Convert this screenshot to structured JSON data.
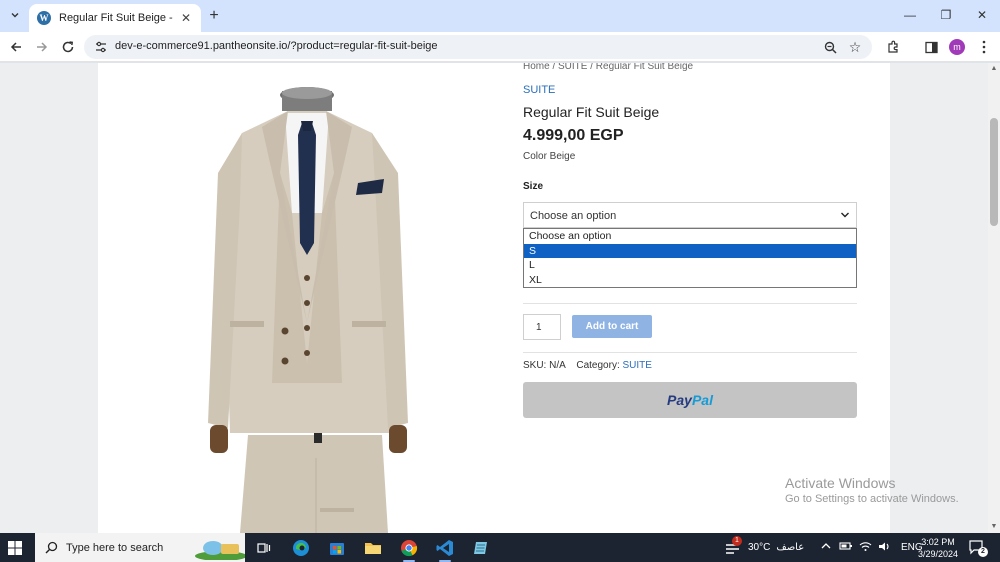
{
  "browser": {
    "tab_title": "Regular Fit Suit Beige -",
    "url": "dev-e-commerce91.pantheonsite.io/?product=regular-fit-suit-beige",
    "profile_initial": "m"
  },
  "product": {
    "breadcrumb": "Home / SUITE / Regular Fit Suit Beige",
    "category_link": "SUITE",
    "title": "Regular Fit Suit Beige",
    "price": "4.999,00 EGP",
    "color_line": "Color Beige",
    "size_label": "Size",
    "size_select": {
      "value": "Choose an option",
      "options": [
        "Choose an option",
        "S",
        "L",
        "XL"
      ],
      "highlighted_index": 1
    },
    "quantity": "1",
    "add_to_cart": "Add to cart",
    "sku_label": "SKU:",
    "sku_value": "N/A",
    "category_label": "Category:",
    "category_value": "SUITE",
    "paypal_pay": "Pay",
    "paypal_pal": "Pal"
  },
  "activate_windows": {
    "title": "Activate Windows",
    "subtitle": "Go to Settings to activate Windows."
  },
  "taskbar": {
    "search_placeholder": "Type here to search",
    "weather_badge": "1",
    "weather_temp": "30°C",
    "weather_desc": "عاصف",
    "language": "ENG",
    "time": "3:02 PM",
    "date": "3/29/2024",
    "notification_count": "2"
  },
  "colors": {
    "link": "#2a6ebb",
    "add_to_cart_bg": "#8fb4e3",
    "selected_option": "#0f62c3",
    "paypal_bg": "#c4c4c4",
    "paypal_dark": "#253b80",
    "paypal_light": "#179bd7",
    "suit": "#d6cdbf"
  }
}
